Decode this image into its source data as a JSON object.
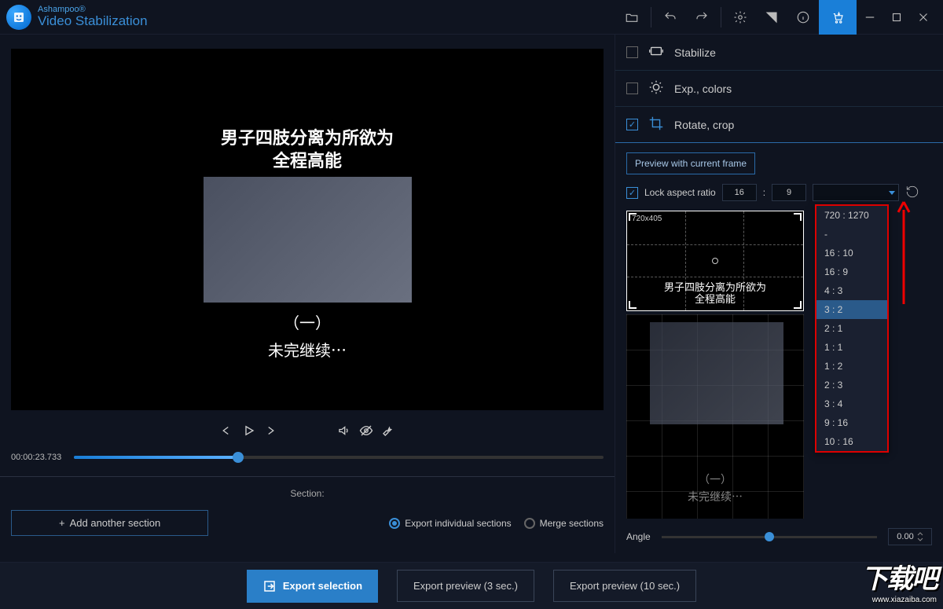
{
  "brand": {
    "top": "Ashampoo®",
    "bottom": "Video Stabilization"
  },
  "panels": {
    "stabilize": "Stabilize",
    "expcolors": "Exp., colors",
    "rotatecrop": "Rotate, crop"
  },
  "previewBtn": "Preview with current frame",
  "lockAspect": "Lock aspect ratio",
  "aspectW": "16",
  "aspectH": "9",
  "cropDims": "720x405",
  "ratioOptions": [
    "720 : 1270",
    "-",
    "16 : 10",
    "16 : 9",
    "4 : 3",
    "3 : 2",
    "2 : 1",
    "1 : 1",
    "1 : 2",
    "2 : 3",
    "3 : 4",
    "9 : 16",
    "10 : 16"
  ],
  "ratioHighlight": "3 : 2",
  "angleLabel": "Angle",
  "angleValue": "0.00",
  "timecode": "00:00:23.733",
  "sectionLabel": "Section:",
  "addSection": "Add another section",
  "exportIndividual": "Export individual sections",
  "mergeSections": "Merge sections",
  "exportSelection": "Export selection",
  "exportPreview3": "Export preview (3 sec.)",
  "exportPreview10": "Export preview (10 sec.)",
  "vid": {
    "line1": "男子四肢分离为所欲为",
    "line2": "全程高能",
    "line3": "（一）",
    "line4": "未完继续⋯"
  },
  "cropText": {
    "line1": "男子四肢分离为所欲为",
    "line2": "全程高能"
  },
  "bgText": {
    "line1": "（一）",
    "line2": "未完继续⋯"
  },
  "watermark": {
    "big": "下载吧",
    "small": "www.xiazaiba.com"
  }
}
